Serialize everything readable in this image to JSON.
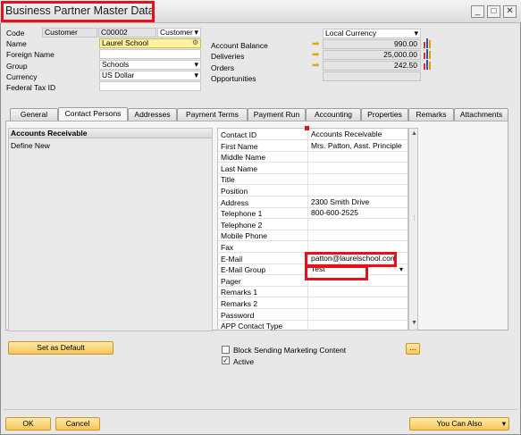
{
  "window": {
    "title": "Business Partner Master Data",
    "min_glyph": "_",
    "max_glyph": "□",
    "close_glyph": "✕"
  },
  "header": {
    "code_label": "Code",
    "code_type": "Customer",
    "code_value": "C00002",
    "code_kind": "Customer",
    "name_label": "Name",
    "name_value": "Laurel School",
    "foreign_name_label": "Foreign Name",
    "foreign_name_value": "",
    "group_label": "Group",
    "group_value": "Schools",
    "currency_label": "Currency",
    "currency_value": "US Dollar",
    "federal_tax_label": "Federal Tax ID",
    "federal_tax_value": "",
    "currency_mode": "Local Currency",
    "account_balance_label": "Account Balance",
    "account_balance_value": "990.00",
    "deliveries_label": "Deliveries",
    "deliveries_value": "25,000.00",
    "orders_label": "Orders",
    "orders_value": "242.50",
    "opportunities_label": "Opportunities",
    "opportunities_value": ""
  },
  "tabs": [
    "General",
    "Contact Persons",
    "Addresses",
    "Payment Terms",
    "Payment Run",
    "Accounting",
    "Properties",
    "Remarks",
    "Attachments"
  ],
  "active_tab": "Contact Persons",
  "contact_list": {
    "header": "Accounts Receivable",
    "items": [
      "Define New"
    ]
  },
  "contact_fields": [
    {
      "key": "Contact ID",
      "value": "Accounts Receivable"
    },
    {
      "key": "First Name",
      "value": "Mrs. Patton, Asst. Principle"
    },
    {
      "key": "Middle Name",
      "value": ""
    },
    {
      "key": "Last Name",
      "value": ""
    },
    {
      "key": "Title",
      "value": ""
    },
    {
      "key": "Position",
      "value": ""
    },
    {
      "key": "Address",
      "value": "2300 Smith Drive"
    },
    {
      "key": "Telephone 1",
      "value": "800-600-2525"
    },
    {
      "key": "Telephone 2",
      "value": ""
    },
    {
      "key": "Mobile Phone",
      "value": ""
    },
    {
      "key": "Fax",
      "value": ""
    },
    {
      "key": "E-Mail",
      "value": "patton@laurelschool.com"
    },
    {
      "key": "E-Mail Group",
      "value": "Test"
    },
    {
      "key": "Pager",
      "value": ""
    },
    {
      "key": "Remarks 1",
      "value": ""
    },
    {
      "key": "Remarks 2",
      "value": ""
    },
    {
      "key": "Password",
      "value": ""
    },
    {
      "key": "APP Contact Type",
      "value": ""
    }
  ],
  "buttons": {
    "set_default": "Set as Default",
    "ok": "OK",
    "cancel": "Cancel",
    "you_can_also": "You Can Also",
    "ellipsis": "..."
  },
  "checkboxes": {
    "block_marketing": "Block Sending Marketing Content",
    "block_marketing_checked": false,
    "active": "Active",
    "active_checked": true,
    "check_glyph": "✓"
  },
  "colors": {
    "highlight_red": "#e8101a",
    "button_gold": "#f7c65a",
    "arrow_orange": "#e3a400"
  }
}
